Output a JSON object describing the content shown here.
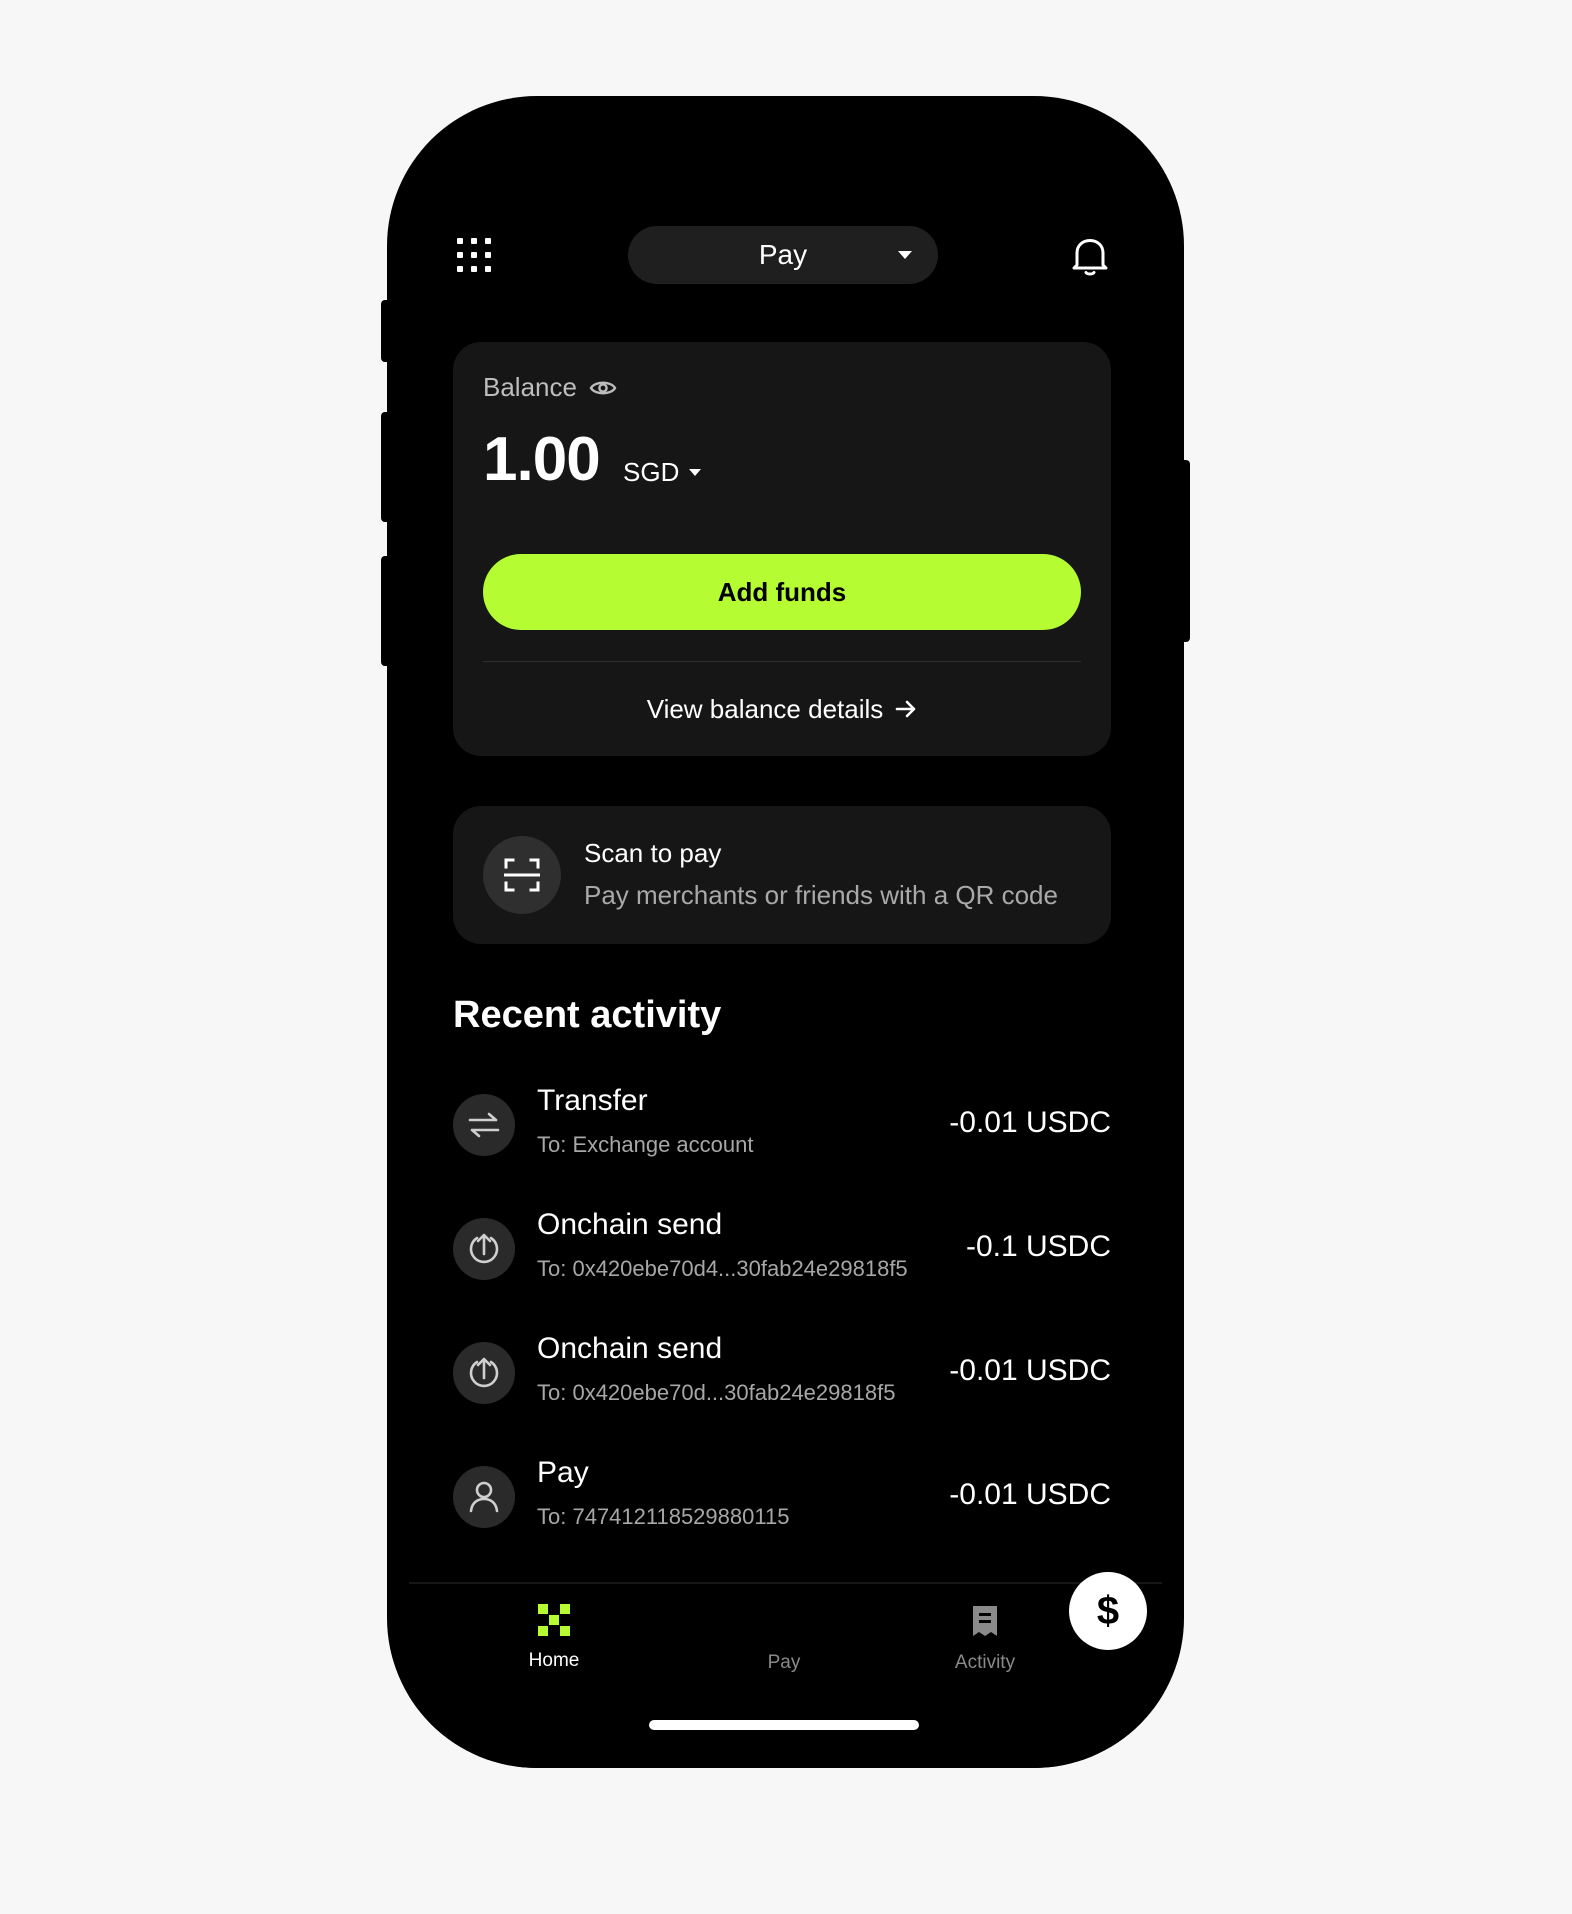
{
  "header": {
    "mode_select_label": "Pay",
    "menu_icon": "grid-icon",
    "notifications_icon": "bell-icon"
  },
  "balance": {
    "label": "Balance",
    "visibility_icon": "eye-icon",
    "amount": "1.00",
    "currency": "SGD",
    "add_funds_label": "Add funds",
    "view_details_label": "View balance details",
    "view_details_icon": "arrow-right-icon"
  },
  "scan": {
    "title": "Scan to pay",
    "subtitle": "Pay merchants or friends with a QR code",
    "icon": "qr-scan-icon"
  },
  "recent_activity": {
    "title": "Recent activity",
    "items": [
      {
        "icon": "transfer-icon",
        "title": "Transfer",
        "subtitle": "To: Exchange account",
        "amount": "-0.01 USDC"
      },
      {
        "icon": "onchain-send-icon",
        "title": "Onchain send",
        "subtitle": "To: 0x420ebe70d4...30fab24e29818f5",
        "amount": "-0.1 USDC"
      },
      {
        "icon": "onchain-send-icon",
        "title": "Onchain send",
        "subtitle": "To: 0x420ebe70d...30fab24e29818f5",
        "amount": "-0.01 USDC"
      },
      {
        "icon": "user-icon",
        "title": "Pay",
        "subtitle": "To: 747412118529880115",
        "amount": "-0.01 USDC"
      }
    ]
  },
  "bottom_nav": {
    "home_label": "Home",
    "pay_label": "Pay",
    "pay_symbol": "$",
    "activity_label": "Activity",
    "active": "Home"
  },
  "colors": {
    "accent": "#b6fc32",
    "background": "#000000",
    "card": "#161616",
    "page": "#f7f7f7"
  }
}
